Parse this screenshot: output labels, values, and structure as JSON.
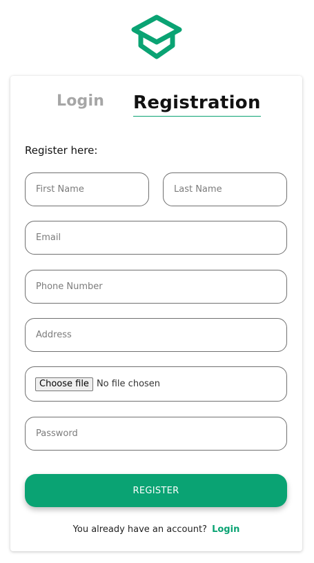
{
  "brand": {
    "logo_icon": "graduation-cap-icon",
    "accent_color": "#0aa373"
  },
  "tabs": {
    "login_label": "Login",
    "registration_label": "Registration",
    "active": "Registration"
  },
  "form": {
    "heading": "Register here:",
    "first_name_placeholder": "First Name",
    "last_name_placeholder": "Last Name",
    "email_placeholder": "Email",
    "phone_placeholder": "Phone Number",
    "address_placeholder": "Address",
    "file_button_label": "Choose file",
    "file_status": "No file chosen",
    "password_placeholder": "Password",
    "submit_label": "REGISTER"
  },
  "footer": {
    "prompt": "You already have an account?",
    "link_label": "Login"
  }
}
